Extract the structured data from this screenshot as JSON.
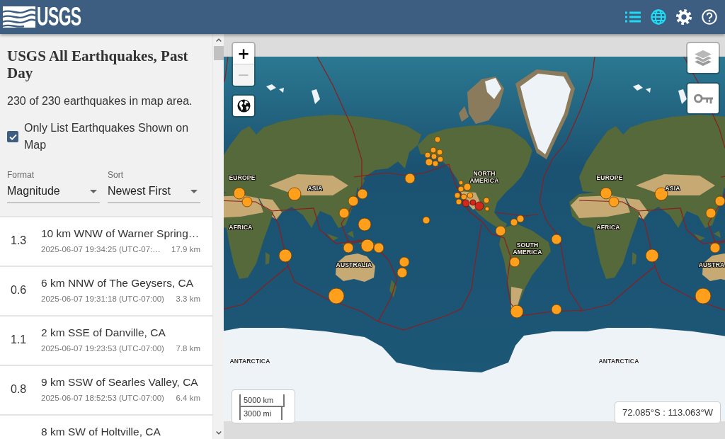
{
  "header": {
    "logo": "USGS",
    "list_button": {
      "on": true
    },
    "map_button": {
      "on": true
    },
    "settings_button": {
      "on": false
    },
    "help_button": {
      "on": false
    }
  },
  "sidebar": {
    "title": "USGS All Earthquakes, Past Day",
    "count": "230 of 230 earthquakes in map area.",
    "filter_checkbox": {
      "label": "Only List Earthquakes Shown on Map",
      "checked": true
    },
    "format": {
      "label": "Format",
      "value": "Magnitude"
    },
    "sort": {
      "label": "Sort",
      "value": "Newest First"
    },
    "earthquakes": [
      {
        "magnitude": "1.3",
        "place": "10 km WNW of Warner Spring…",
        "time": "2025-06-07 19:34:25 (UTC-07:…",
        "depth": "17.9 km"
      },
      {
        "magnitude": "0.6",
        "place": "6 km NNW of The Geysers, CA",
        "time": "2025-06-07 19:31:18 (UTC-07:00)",
        "depth": "3.3 km"
      },
      {
        "magnitude": "1.1",
        "place": "2 km SSE of Danville, CA",
        "time": "2025-06-07 19:23:53 (UTC-07:00)",
        "depth": "7.8 km"
      },
      {
        "magnitude": "0.8",
        "place": "9 km SSW of Searles Valley, CA",
        "time": "2025-06-07 18:52:53 (UTC-07:00)",
        "depth": "6.4 km"
      },
      {
        "place": "8 km SW of Holtville, CA"
      }
    ]
  },
  "map": {
    "zoom_in": {
      "label": "+",
      "disabled": false
    },
    "zoom_out": {
      "label": "−",
      "disabled": true
    },
    "labels": [
      "EUROPE",
      "NORTH AMERICA",
      "EUROPE",
      "ASIA",
      "ASIA",
      "AFRICA",
      "AFRICA",
      "SOUTH AMERICA",
      "AUSTRALIA",
      "AUSTRA",
      "ANTARCTICA",
      "ANTARCTICA"
    ],
    "scale": {
      "metric": "5000 km",
      "imperial": "3000 mi"
    },
    "coordinates": "72.085°S : 113.063°W"
  }
}
